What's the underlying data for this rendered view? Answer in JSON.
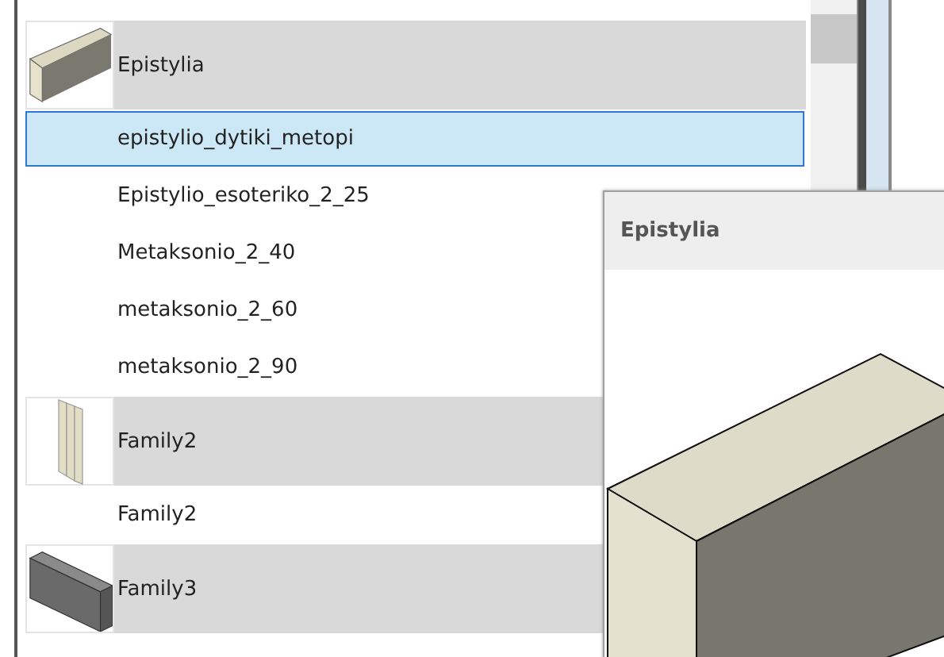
{
  "families": [
    {
      "name": "Epistylia",
      "kind": "beam",
      "items": [
        {
          "name": "epistylio_dytiki_metopi",
          "selected": true
        },
        {
          "name": "Epistylio_esoteriko_2_25",
          "selected": false
        },
        {
          "name": "Metaksonio_2_40",
          "selected": false
        },
        {
          "name": "metaksonio_2_60",
          "selected": false
        },
        {
          "name": "metaksonio_2_90",
          "selected": false
        }
      ]
    },
    {
      "name": "Family2",
      "kind": "panels",
      "items": [
        {
          "name": "Family2",
          "selected": false
        }
      ]
    },
    {
      "name": "Family3",
      "kind": "dark-beam"
    }
  ],
  "preview": {
    "title": "Epistylia"
  }
}
